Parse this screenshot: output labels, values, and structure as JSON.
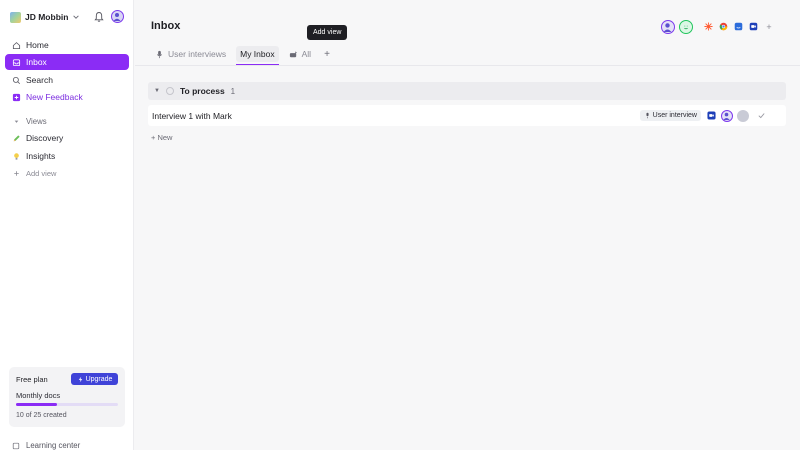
{
  "workspace": {
    "name": "JD Mobbin"
  },
  "sidebar": {
    "items": [
      {
        "label": "Home"
      },
      {
        "label": "Inbox"
      },
      {
        "label": "Search"
      },
      {
        "label": "New Feedback"
      }
    ],
    "views_label": "Views",
    "views": [
      {
        "label": "Discovery"
      },
      {
        "label": "Insights"
      }
    ],
    "add_view_label": "Add view",
    "plan": {
      "title": "Free plan",
      "upgrade_label": "Upgrade",
      "subtitle": "Monthly docs",
      "used": 10,
      "total": 25,
      "count_text": "10 of 25 created"
    },
    "learning_label": "Learning center"
  },
  "main": {
    "title": "Inbox",
    "tabs": [
      {
        "label": "User interviews",
        "icon": "microphone-icon"
      },
      {
        "label": "My Inbox",
        "active": true
      },
      {
        "label": "All",
        "icon": "mailbox-icon"
      }
    ],
    "add_tab_label": "+",
    "tooltip": "Add view",
    "integrations": [
      "hubspot-icon",
      "chrome-icon",
      "intercom-icon",
      "zoom-icon"
    ],
    "integrations_add": "+",
    "group": {
      "title": "To process",
      "count": "1"
    },
    "rows": [
      {
        "title": "Interview 1 with Mark",
        "tag": "User interview"
      }
    ],
    "new_label": "+ New"
  },
  "colors": {
    "accent": "#8b2cf5",
    "upgrade": "#3f43d8"
  }
}
